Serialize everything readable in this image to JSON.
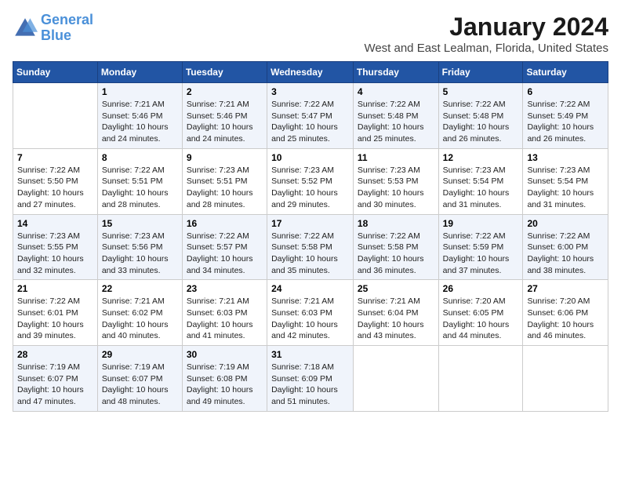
{
  "header": {
    "logo_line1": "General",
    "logo_line2": "Blue",
    "title": "January 2024",
    "subtitle": "West and East Lealman, Florida, United States"
  },
  "days_of_week": [
    "Sunday",
    "Monday",
    "Tuesday",
    "Wednesday",
    "Thursday",
    "Friday",
    "Saturday"
  ],
  "weeks": [
    [
      {
        "day": "",
        "empty": true
      },
      {
        "day": "1",
        "sunrise": "7:21 AM",
        "sunset": "5:46 PM",
        "daylight": "10 hours and 24 minutes."
      },
      {
        "day": "2",
        "sunrise": "7:21 AM",
        "sunset": "5:46 PM",
        "daylight": "10 hours and 24 minutes."
      },
      {
        "day": "3",
        "sunrise": "7:22 AM",
        "sunset": "5:47 PM",
        "daylight": "10 hours and 25 minutes."
      },
      {
        "day": "4",
        "sunrise": "7:22 AM",
        "sunset": "5:48 PM",
        "daylight": "10 hours and 25 minutes."
      },
      {
        "day": "5",
        "sunrise": "7:22 AM",
        "sunset": "5:48 PM",
        "daylight": "10 hours and 26 minutes."
      },
      {
        "day": "6",
        "sunrise": "7:22 AM",
        "sunset": "5:49 PM",
        "daylight": "10 hours and 26 minutes."
      }
    ],
    [
      {
        "day": "7",
        "sunrise": "7:22 AM",
        "sunset": "5:50 PM",
        "daylight": "10 hours and 27 minutes."
      },
      {
        "day": "8",
        "sunrise": "7:22 AM",
        "sunset": "5:51 PM",
        "daylight": "10 hours and 28 minutes."
      },
      {
        "day": "9",
        "sunrise": "7:23 AM",
        "sunset": "5:51 PM",
        "daylight": "10 hours and 28 minutes."
      },
      {
        "day": "10",
        "sunrise": "7:23 AM",
        "sunset": "5:52 PM",
        "daylight": "10 hours and 29 minutes."
      },
      {
        "day": "11",
        "sunrise": "7:23 AM",
        "sunset": "5:53 PM",
        "daylight": "10 hours and 30 minutes."
      },
      {
        "day": "12",
        "sunrise": "7:23 AM",
        "sunset": "5:54 PM",
        "daylight": "10 hours and 31 minutes."
      },
      {
        "day": "13",
        "sunrise": "7:23 AM",
        "sunset": "5:54 PM",
        "daylight": "10 hours and 31 minutes."
      }
    ],
    [
      {
        "day": "14",
        "sunrise": "7:23 AM",
        "sunset": "5:55 PM",
        "daylight": "10 hours and 32 minutes."
      },
      {
        "day": "15",
        "sunrise": "7:23 AM",
        "sunset": "5:56 PM",
        "daylight": "10 hours and 33 minutes."
      },
      {
        "day": "16",
        "sunrise": "7:22 AM",
        "sunset": "5:57 PM",
        "daylight": "10 hours and 34 minutes."
      },
      {
        "day": "17",
        "sunrise": "7:22 AM",
        "sunset": "5:58 PM",
        "daylight": "10 hours and 35 minutes."
      },
      {
        "day": "18",
        "sunrise": "7:22 AM",
        "sunset": "5:58 PM",
        "daylight": "10 hours and 36 minutes."
      },
      {
        "day": "19",
        "sunrise": "7:22 AM",
        "sunset": "5:59 PM",
        "daylight": "10 hours and 37 minutes."
      },
      {
        "day": "20",
        "sunrise": "7:22 AM",
        "sunset": "6:00 PM",
        "daylight": "10 hours and 38 minutes."
      }
    ],
    [
      {
        "day": "21",
        "sunrise": "7:22 AM",
        "sunset": "6:01 PM",
        "daylight": "10 hours and 39 minutes."
      },
      {
        "day": "22",
        "sunrise": "7:21 AM",
        "sunset": "6:02 PM",
        "daylight": "10 hours and 40 minutes."
      },
      {
        "day": "23",
        "sunrise": "7:21 AM",
        "sunset": "6:03 PM",
        "daylight": "10 hours and 41 minutes."
      },
      {
        "day": "24",
        "sunrise": "7:21 AM",
        "sunset": "6:03 PM",
        "daylight": "10 hours and 42 minutes."
      },
      {
        "day": "25",
        "sunrise": "7:21 AM",
        "sunset": "6:04 PM",
        "daylight": "10 hours and 43 minutes."
      },
      {
        "day": "26",
        "sunrise": "7:20 AM",
        "sunset": "6:05 PM",
        "daylight": "10 hours and 44 minutes."
      },
      {
        "day": "27",
        "sunrise": "7:20 AM",
        "sunset": "6:06 PM",
        "daylight": "10 hours and 46 minutes."
      }
    ],
    [
      {
        "day": "28",
        "sunrise": "7:19 AM",
        "sunset": "6:07 PM",
        "daylight": "10 hours and 47 minutes."
      },
      {
        "day": "29",
        "sunrise": "7:19 AM",
        "sunset": "6:07 PM",
        "daylight": "10 hours and 48 minutes."
      },
      {
        "day": "30",
        "sunrise": "7:19 AM",
        "sunset": "6:08 PM",
        "daylight": "10 hours and 49 minutes."
      },
      {
        "day": "31",
        "sunrise": "7:18 AM",
        "sunset": "6:09 PM",
        "daylight": "10 hours and 51 minutes."
      },
      {
        "day": "",
        "empty": true
      },
      {
        "day": "",
        "empty": true
      },
      {
        "day": "",
        "empty": true
      }
    ]
  ]
}
